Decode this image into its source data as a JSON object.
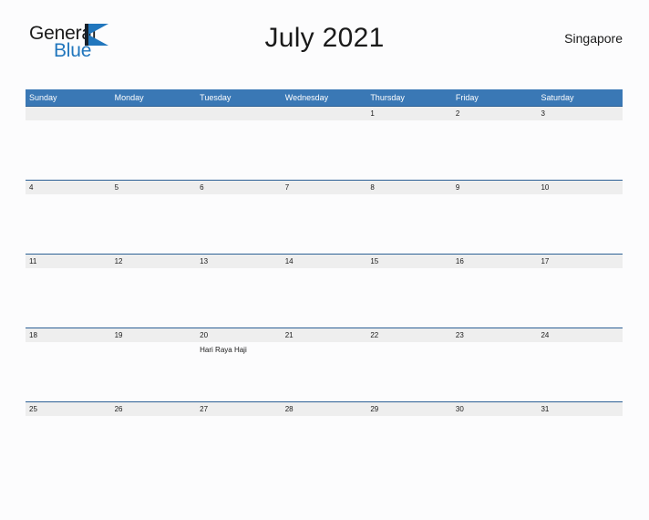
{
  "brand": {
    "name_part1": "General",
    "name_part2": "Blue",
    "accent_color": "#2176bd",
    "dark_color": "#16202b"
  },
  "header": {
    "title": "July 2021",
    "locale": "Singapore"
  },
  "calendar": {
    "header_color": "#3a78b5",
    "band_color": "#eeeeee",
    "rule_color": "#2c6095",
    "weekdays": [
      "Sunday",
      "Monday",
      "Tuesday",
      "Wednesday",
      "Thursday",
      "Friday",
      "Saturday"
    ],
    "weeks": [
      [
        {
          "date": "",
          "events": []
        },
        {
          "date": "",
          "events": []
        },
        {
          "date": "",
          "events": []
        },
        {
          "date": "",
          "events": []
        },
        {
          "date": "1",
          "events": []
        },
        {
          "date": "2",
          "events": []
        },
        {
          "date": "3",
          "events": []
        }
      ],
      [
        {
          "date": "4",
          "events": []
        },
        {
          "date": "5",
          "events": []
        },
        {
          "date": "6",
          "events": []
        },
        {
          "date": "7",
          "events": []
        },
        {
          "date": "8",
          "events": []
        },
        {
          "date": "9",
          "events": []
        },
        {
          "date": "10",
          "events": []
        }
      ],
      [
        {
          "date": "11",
          "events": []
        },
        {
          "date": "12",
          "events": []
        },
        {
          "date": "13",
          "events": []
        },
        {
          "date": "14",
          "events": []
        },
        {
          "date": "15",
          "events": []
        },
        {
          "date": "16",
          "events": []
        },
        {
          "date": "17",
          "events": []
        }
      ],
      [
        {
          "date": "18",
          "events": []
        },
        {
          "date": "19",
          "events": []
        },
        {
          "date": "20",
          "events": [
            "Hari Raya Haji"
          ]
        },
        {
          "date": "21",
          "events": []
        },
        {
          "date": "22",
          "events": []
        },
        {
          "date": "23",
          "events": []
        },
        {
          "date": "24",
          "events": []
        }
      ],
      [
        {
          "date": "25",
          "events": []
        },
        {
          "date": "26",
          "events": []
        },
        {
          "date": "27",
          "events": []
        },
        {
          "date": "28",
          "events": []
        },
        {
          "date": "29",
          "events": []
        },
        {
          "date": "30",
          "events": []
        },
        {
          "date": "31",
          "events": []
        }
      ]
    ]
  }
}
